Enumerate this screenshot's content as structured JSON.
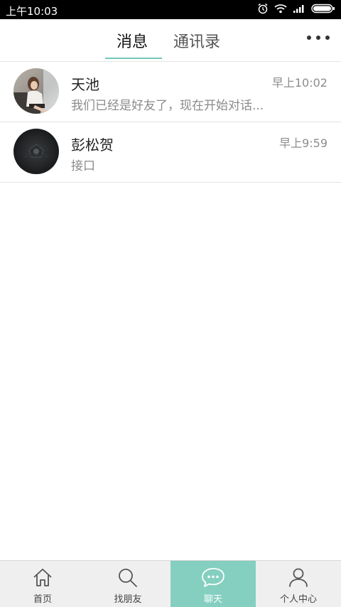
{
  "status_bar": {
    "time": "上午10:03",
    "icons": [
      "alarm-icon",
      "wifi-icon",
      "signal-icon",
      "battery-icon"
    ]
  },
  "header": {
    "tabs": [
      {
        "label": "消息",
        "active": true
      },
      {
        "label": "通讯录",
        "active": false
      }
    ],
    "more_icon": "more-dots-icon",
    "accent_color": "#6fc7b8"
  },
  "conversations": [
    {
      "name": "天池",
      "preview": "我们已经是好友了，现在开始对话...",
      "time": "早上10:02",
      "avatar": "photo-avatar-girl"
    },
    {
      "name": "彭松贺",
      "preview": "接口",
      "time": "早上9:59",
      "avatar": "photo-avatar-dark"
    }
  ],
  "bottom_nav": {
    "items": [
      {
        "label": "首页",
        "icon": "home-icon",
        "active": false
      },
      {
        "label": "找朋友",
        "icon": "search-icon",
        "active": false
      },
      {
        "label": "聊天",
        "icon": "chat-bubble-icon",
        "active": true
      },
      {
        "label": "个人中心",
        "icon": "person-icon",
        "active": false
      }
    ],
    "active_color": "#84cfc0"
  }
}
